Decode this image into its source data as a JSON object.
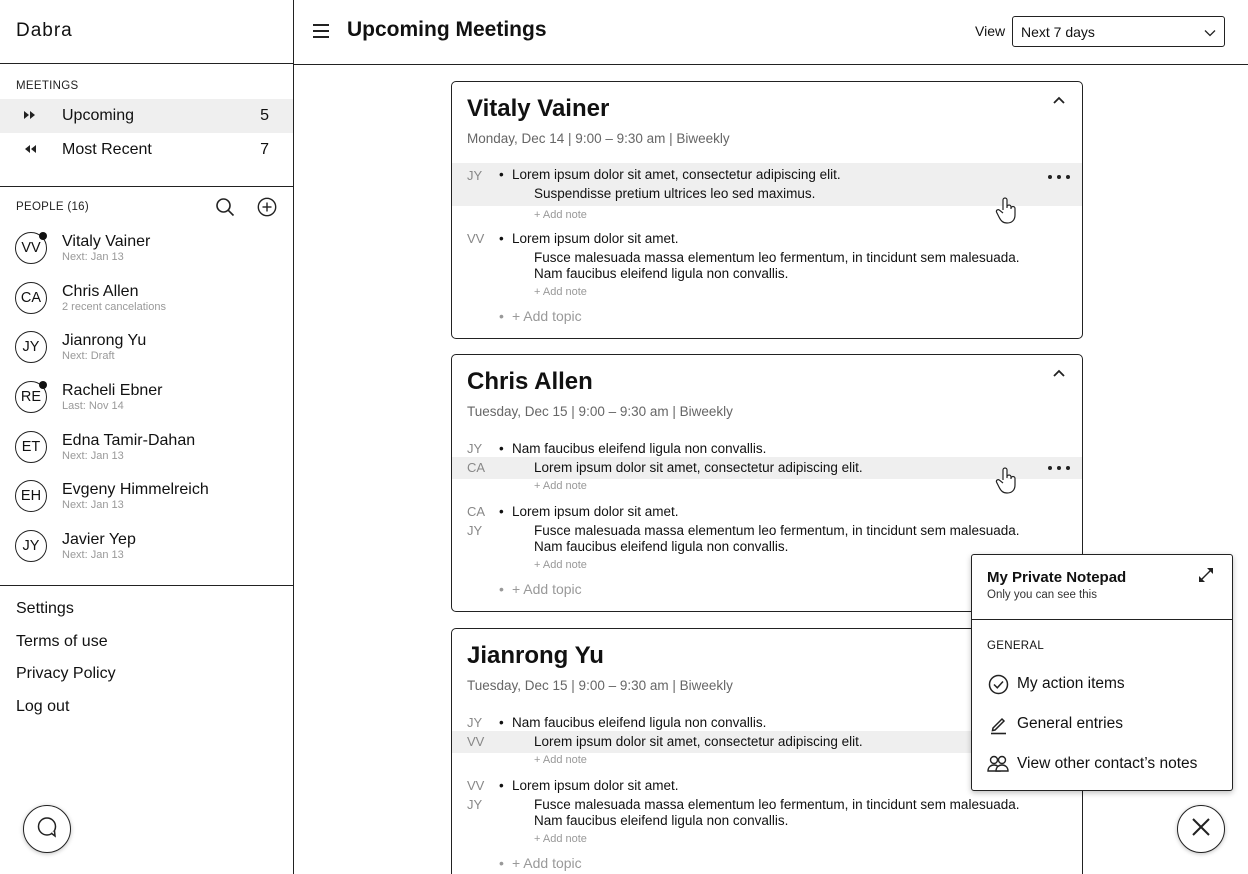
{
  "app": {
    "logo": "Dabra"
  },
  "header": {
    "title": "Upcoming Meetings",
    "view_label": "View",
    "view_value": "Next 7 days"
  },
  "sidebar": {
    "meetings_title": "MEETINGS",
    "nav": [
      {
        "label": "Upcoming",
        "count": "5",
        "icon": "fast-forward-icon"
      },
      {
        "label": "Most Recent",
        "count": "7",
        "icon": "rewind-icon"
      }
    ],
    "people_title": "PEOPLE (16)",
    "people": [
      {
        "initials": "VV",
        "name": "Vitaly Vainer",
        "sub": "Next: Jan 13",
        "dot": true
      },
      {
        "initials": "CA",
        "name": "Chris Allen",
        "sub": "2 recent cancelations",
        "dot": false
      },
      {
        "initials": "JY",
        "name": "Jianrong Yu",
        "sub": "Next: Draft",
        "dot": false
      },
      {
        "initials": "RE",
        "name": "Racheli Ebner",
        "sub": "Last: Nov 14",
        "dot": true
      },
      {
        "initials": "ET",
        "name": "Edna Tamir-Dahan",
        "sub": "Next: Jan 13",
        "dot": false
      },
      {
        "initials": "EH",
        "name": "Evgeny Himmelreich",
        "sub": "Next: Jan 13",
        "dot": false
      },
      {
        "initials": "JY",
        "name": "Javier Yep",
        "sub": "Next: Jan 13",
        "dot": false
      }
    ],
    "links": [
      "Settings",
      "Terms of use",
      "Privacy Policy",
      "Log out"
    ]
  },
  "common": {
    "add_note": "+ Add note",
    "add_topic": "+ Add topic"
  },
  "cards": [
    {
      "name": "Vitaly Vainer",
      "meta": "Monday, Dec 14  |  9:00 – 9:30 am  |  Biweekly",
      "t1_author": "JY",
      "t1_text": "Lorem ipsum dolor sit amet, consectetur adipiscing elit.",
      "t1_sub": "Suspendisse pretium ultrices leo sed maximus.",
      "t2_author": "VV",
      "t2_text": "Lorem ipsum dolor sit amet.",
      "t2_sub1": "Fusce malesuada massa elementum leo fermentum, in tincidunt sem malesuada.",
      "t2_sub2": "Nam faucibus eleifend ligula non convallis."
    },
    {
      "name": "Chris Allen",
      "meta": "Tuesday, Dec 15  |  9:00 – 9:30 am  |  Biweekly",
      "t1_author": "JY",
      "t1_text": "Nam faucibus eleifend ligula non convallis.",
      "t1_sub_author": "CA",
      "t1_sub": "Lorem ipsum dolor sit amet, consectetur adipiscing elit.",
      "t2_author": "CA",
      "t2_text": "Lorem ipsum dolor sit amet.",
      "t2_sub_author": "JY",
      "t2_sub1": "Fusce malesuada massa elementum leo fermentum, in tincidunt sem malesuada.",
      "t2_sub2": "Nam faucibus eleifend ligula non convallis."
    },
    {
      "name": "Jianrong Yu",
      "meta": "Tuesday, Dec 15  |  9:00 – 9:30 am  |  Biweekly",
      "t1_author": "JY",
      "t1_text": "Nam faucibus eleifend ligula non convallis.",
      "t1_sub_author": "VV",
      "t1_sub": "Lorem ipsum dolor sit amet, consectetur adipiscing elit.",
      "t2_author": "VV",
      "t2_text": "Lorem ipsum dolor sit amet.",
      "t2_sub_author": "JY",
      "t2_sub1": "Fusce malesuada massa elementum leo fermentum, in tincidunt sem malesuada.",
      "t2_sub2": "Nam faucibus eleifend ligula non convallis."
    }
  ],
  "notepad": {
    "title": "My Private Notepad",
    "subtitle": "Only you can see this",
    "section": "GENERAL",
    "items": [
      "My action items",
      "General entries",
      "View other contact’s notes"
    ]
  }
}
